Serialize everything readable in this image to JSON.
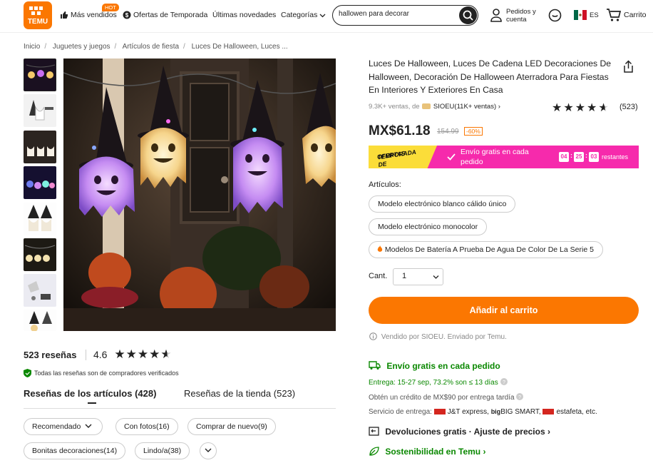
{
  "header": {
    "logo_text": "TEMU",
    "nav": [
      {
        "label": "Más vendidos",
        "icon": "thumbs-up-icon",
        "badge": "HOT"
      },
      {
        "label": "Ofertas de Temporada",
        "icon": "dollar-icon"
      },
      {
        "label": "Últimas novedades"
      },
      {
        "label": "Categorías",
        "icon": "chevron-down-icon"
      }
    ],
    "search_value": "hallowen para decorar",
    "account_line1": "Pedidos y",
    "account_line2": "cuenta",
    "language": "ES",
    "cart_label": "Carrito"
  },
  "breadcrumb": [
    "Inicio",
    "Juguetes y juegos",
    "Artículos de fiesta",
    "Luces De Halloween, Luces ..."
  ],
  "product": {
    "title": "Luces De Halloween, Luces De Cadena LED Decoraciones De Halloween, Decoración De Halloween Aterradora Para Fiestas En Interiores Y Exteriores En Casa",
    "sales": "9.3K+ ventas, de",
    "seller": "SIOEU(11K+ ventas)",
    "rating_stars": 4.5,
    "review_count": "(523)",
    "price": "MX$61.18",
    "old_price": "154.99",
    "discount": "-60%",
    "promo_badge_line1": "OFERTAS DE",
    "promo_badge_line2": "TEMPORADA",
    "promo_text": "Envío gratis en cada pedido",
    "timer": [
      "04",
      "25",
      "03"
    ],
    "timer_suffix": "restantes",
    "articles_label": "Artículos:",
    "options": [
      "Modelo electrónico blanco cálido único",
      "Modelo electrónico monocolor",
      "Modelos De Batería A Prueba De Agua De Color De La Serie 5"
    ],
    "qty_label": "Cant.",
    "qty_value": "1",
    "add_to_cart": "Añadir al carrito",
    "sold_by": "Vendido por SIOEU. Enviado por Temu.",
    "free_shipping": "Envío gratis en cada pedido",
    "delivery": "Entrega: 15-27 sep, 73.2% son ≤ 13 días",
    "credit": "Obtén un crédito de MX$90 por entrega tardía",
    "service_label": "Servicio de entrega:",
    "carriers": [
      "J&T express,",
      "BIG SMART,",
      "estafeta, etc."
    ],
    "returns": "Devoluciones gratis · Ajuste de precios",
    "sustainability": "Sostenibilidad en Temu"
  },
  "reviews": {
    "count_label": "523 reseñas",
    "score": "4.6",
    "verified": "Todas las reseñas son de compradores verificados",
    "tabs": [
      "Reseñas de los artículos (428)",
      "Reseñas de la tienda (523)"
    ],
    "filters": [
      "Recomendado",
      "Con fotos(16)",
      "Comprar de nuevo(9)",
      "Bonitas decoraciones(14)",
      "Lindo/a(38)"
    ]
  },
  "colors": {
    "brand_orange": "#fb7701",
    "promo_pink": "#f62aac",
    "promo_yellow": "#fbdd39",
    "success_green": "#0a8800"
  }
}
